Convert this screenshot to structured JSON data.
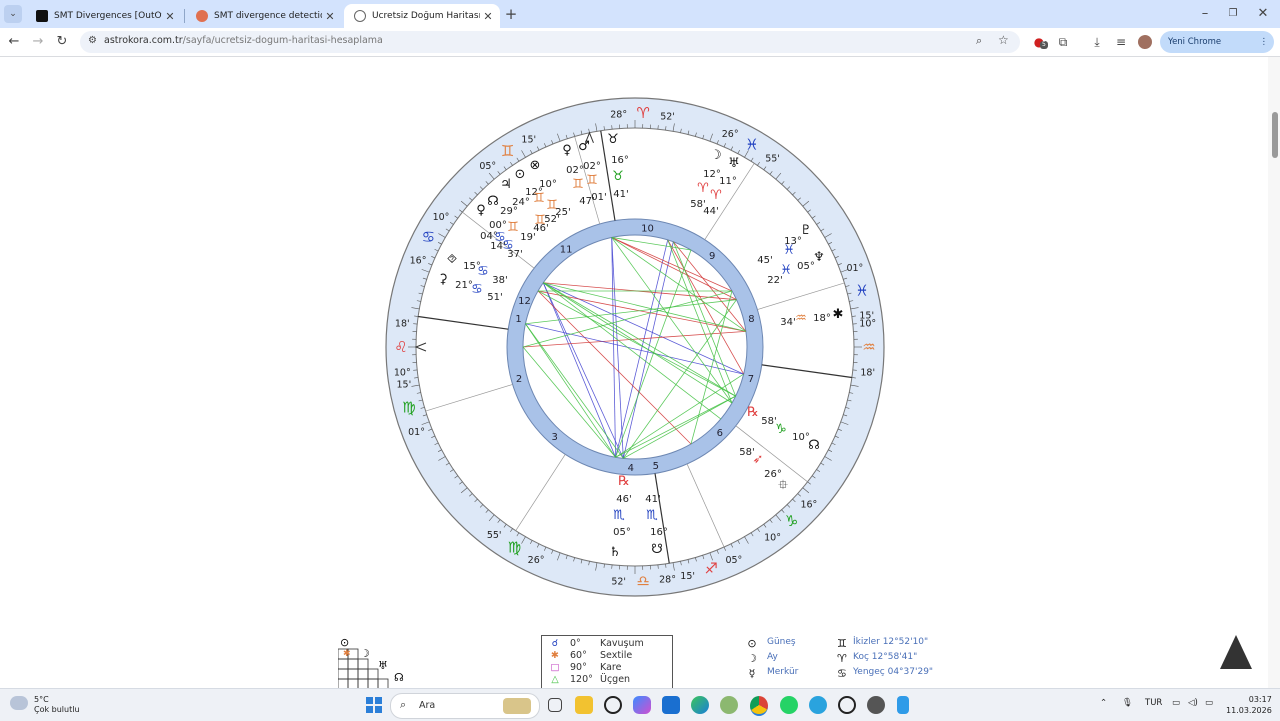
{
  "browser": {
    "tabs": [
      {
        "title": "SMT Divergences [OutOfOption",
        "active": false
      },
      {
        "title": "SMT divergence detection ve n",
        "active": false
      },
      {
        "title": "Ücretsiz Doğum Haritası Hesap",
        "active": true
      }
    ],
    "url_host": "astrokora.com.tr",
    "url_path": "/sayfa/ucretsiz-dogum-haritasi-hesaplama",
    "extension_badge": "5",
    "chrome_button": "Yeni Chrome kullanılabilir"
  },
  "chart": {
    "signs": [
      {
        "glyph": "♈",
        "deg": "28°",
        "min": "52'",
        "color": "#e04040"
      },
      {
        "glyph": "♓",
        "deg": "26°",
        "min": "55'",
        "color": "#2040c0"
      },
      {
        "glyph": "♓",
        "deg": "01°",
        "min": "15'",
        "color": "#2040c0"
      },
      {
        "glyph": "♒",
        "deg": "10°",
        "min": "18'",
        "color": "#e08040"
      },
      {
        "glyph": "♑",
        "deg": "16°",
        "min": "10°",
        "color": "#20a020"
      },
      {
        "glyph": "♐",
        "deg": "05°",
        "min": "15'",
        "color": "#e04040"
      },
      {
        "glyph": "♎",
        "deg": "28°",
        "min": "52'",
        "color": "#e08040"
      },
      {
        "glyph": "♍",
        "deg": "26°",
        "min": "55'",
        "color": "#20a020"
      },
      {
        "glyph": "♍",
        "deg": "01°",
        "min": "15'",
        "color": "#20a020"
      },
      {
        "glyph": "♌",
        "deg": "10°",
        "min": "18'",
        "color": "#e04040"
      },
      {
        "glyph": "♋",
        "deg": "16°",
        "min": "10°",
        "color": "#2040c0"
      },
      {
        "glyph": "♊",
        "deg": "05°",
        "min": "15'",
        "color": "#e08040"
      }
    ],
    "house_numbers": [
      "10",
      "9",
      "8",
      "7",
      "6",
      "5",
      "4",
      "3",
      "2",
      "1",
      "12",
      "11"
    ],
    "planet_labels": [
      {
        "text": "♉",
        "color": "#111"
      },
      {
        "text": "16°",
        "color": "#222"
      },
      {
        "text": "♉",
        "color": "#20a020"
      },
      {
        "text": "41'",
        "color": "#222"
      },
      {
        "text": "☽",
        "color": "#111"
      },
      {
        "text": "♅",
        "color": "#111"
      },
      {
        "text": "12°",
        "color": "#222"
      },
      {
        "text": "11°",
        "color": "#222"
      },
      {
        "text": "♈",
        "color": "#e04040"
      },
      {
        "text": "♈",
        "color": "#e04040"
      },
      {
        "text": "58'",
        "color": "#222"
      },
      {
        "text": "44'",
        "color": "#222"
      },
      {
        "text": "♇",
        "color": "#111"
      },
      {
        "text": "13°",
        "color": "#222"
      },
      {
        "text": "♓",
        "color": "#2040c0"
      },
      {
        "text": "45'",
        "color": "#222"
      },
      {
        "text": "♆",
        "color": "#111"
      },
      {
        "text": "05°",
        "color": "#222"
      },
      {
        "text": "♓",
        "color": "#2040c0"
      },
      {
        "text": "22'",
        "color": "#222"
      },
      {
        "text": "✱",
        "color": "#111"
      },
      {
        "text": "18°",
        "color": "#222"
      },
      {
        "text": "♒",
        "color": "#e08040"
      },
      {
        "text": "34'",
        "color": "#222"
      },
      {
        "text": "℞",
        "color": "#e04040"
      },
      {
        "text": "♑",
        "color": "#20a020"
      },
      {
        "text": "58'",
        "color": "#222"
      },
      {
        "text": "10°",
        "color": "#222"
      },
      {
        "text": "☊",
        "color": "#111"
      },
      {
        "text": "58'",
        "color": "#222"
      },
      {
        "text": "➶",
        "color": "#e04040"
      },
      {
        "text": "26°",
        "color": "#222"
      },
      {
        "text": "⯐",
        "color": "#111"
      },
      {
        "text": "℞",
        "color": "#e04040"
      },
      {
        "text": "46'",
        "color": "#222"
      },
      {
        "text": "41'",
        "color": "#222"
      },
      {
        "text": "♏",
        "color": "#2040c0"
      },
      {
        "text": "♏",
        "color": "#2040c0"
      },
      {
        "text": "05°",
        "color": "#222"
      },
      {
        "text": "16°",
        "color": "#222"
      },
      {
        "text": "♄",
        "color": "#111"
      },
      {
        "text": "☋",
        "color": "#111"
      },
      {
        "text": "♀",
        "color": "#111"
      },
      {
        "text": "♂",
        "color": "#111"
      },
      {
        "text": "02°",
        "color": "#222"
      },
      {
        "text": "02°",
        "color": "#222"
      },
      {
        "text": "♊",
        "color": "#e08040"
      },
      {
        "text": "♊",
        "color": "#e08040"
      },
      {
        "text": "47'",
        "color": "#222"
      },
      {
        "text": "01'",
        "color": "#222"
      },
      {
        "text": "⊙",
        "color": "#111"
      },
      {
        "text": "⊗",
        "color": "#111"
      },
      {
        "text": "10°",
        "color": "#222"
      },
      {
        "text": "12°",
        "color": "#222"
      },
      {
        "text": "♊",
        "color": "#e08040"
      },
      {
        "text": "♊",
        "color": "#e08040"
      },
      {
        "text": "25'",
        "color": "#222"
      },
      {
        "text": "52'",
        "color": "#222"
      },
      {
        "text": "♃",
        "color": "#111"
      },
      {
        "text": "☊",
        "color": "#111"
      },
      {
        "text": "24°",
        "color": "#222"
      },
      {
        "text": "♊",
        "color": "#e08040"
      },
      {
        "text": "46'",
        "color": "#222"
      },
      {
        "text": "♀",
        "color": "#111"
      },
      {
        "text": "29°",
        "color": "#222"
      },
      {
        "text": "♊",
        "color": "#e08040"
      },
      {
        "text": "19'",
        "color": "#222"
      },
      {
        "text": "00°",
        "color": "#222"
      },
      {
        "text": "04°",
        "color": "#222"
      },
      {
        "text": "♋",
        "color": "#2040c0"
      },
      {
        "text": "♋",
        "color": "#2040c0"
      },
      {
        "text": "14'",
        "color": "#222"
      },
      {
        "text": "37'",
        "color": "#222"
      },
      {
        "text": "⯑",
        "color": "#111"
      },
      {
        "text": "15°",
        "color": "#222"
      },
      {
        "text": "♋",
        "color": "#2040c0"
      },
      {
        "text": "38'",
        "color": "#222"
      },
      {
        "text": "⚳",
        "color": "#111"
      },
      {
        "text": "21°",
        "color": "#222"
      },
      {
        "text": "♋",
        "color": "#2040c0"
      },
      {
        "text": "51'",
        "color": "#222"
      }
    ]
  },
  "legend": [
    {
      "symbol": "☌",
      "degree": "0°",
      "name": "Kavuşum",
      "color": "#2040c0"
    },
    {
      "symbol": "✱",
      "degree": "60°",
      "name": "Sextile",
      "color": "#e08040"
    },
    {
      "symbol": "□",
      "degree": "90°",
      "name": "Kare",
      "color": "#c040c0"
    },
    {
      "symbol": "△",
      "degree": "120°",
      "name": "Üçgen",
      "color": "#40c040"
    }
  ],
  "planet_list": [
    {
      "symbol": "⊙",
      "name": "Güneş",
      "sign_symbol": "♊",
      "sign_value": "İkizler  12°52'10\""
    },
    {
      "symbol": "☽",
      "name": "Ay",
      "sign_symbol": "♈",
      "sign_value": "Koç  12°58'41\""
    },
    {
      "symbol": "☿",
      "name": "Merkür",
      "sign_symbol": "♋",
      "sign_value": "Yengeç 04°37'29\""
    }
  ],
  "aspect_grid": {
    "symbols": [
      "⊙",
      "✱",
      "☽",
      "♅",
      "☊"
    ]
  },
  "taskbar": {
    "weather_temp": "5°C",
    "weather_desc": "Çok bulutlu",
    "search_label": "Ara",
    "language": "TUR",
    "time": "03:17",
    "date": "11.03.2026"
  }
}
